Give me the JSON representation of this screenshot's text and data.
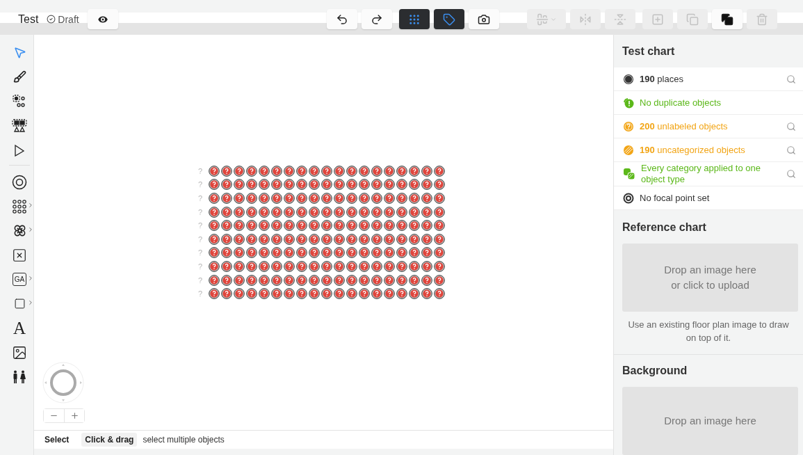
{
  "header": {
    "title": "Test",
    "status": "Draft"
  },
  "toolbar": [
    {
      "kind": "preview",
      "active": false,
      "disabled": false
    },
    {
      "kind": "undo",
      "active": false,
      "disabled": false
    },
    {
      "kind": "redo",
      "active": false,
      "disabled": false
    },
    {
      "kind": "select-places",
      "active": true,
      "disabled": false
    },
    {
      "kind": "labels",
      "active": true,
      "disabled": false
    },
    {
      "kind": "snapshot",
      "active": false,
      "disabled": false
    },
    {
      "kind": "align",
      "active": false,
      "disabled": true
    },
    {
      "kind": "flip-horizontal",
      "active": false,
      "disabled": true
    },
    {
      "kind": "flip-vertical",
      "active": false,
      "disabled": true
    },
    {
      "kind": "duplicate",
      "active": false,
      "disabled": true
    },
    {
      "kind": "copy",
      "active": false,
      "disabled": true
    },
    {
      "kind": "paste",
      "active": false,
      "disabled": false
    },
    {
      "kind": "delete",
      "active": false,
      "disabled": true
    }
  ],
  "tools": [
    {
      "kind": "pointer",
      "selected": true,
      "submenu": false
    },
    {
      "kind": "brush",
      "selected": false,
      "submenu": false
    },
    {
      "kind": "seat-select",
      "selected": false,
      "submenu": false
    },
    {
      "kind": "group-select",
      "selected": false,
      "submenu": false
    },
    {
      "kind": "node",
      "selected": false,
      "submenu": false
    },
    {
      "kind": "focal",
      "selected": false,
      "submenu": false
    },
    {
      "kind": "grid",
      "selected": false,
      "submenu": true
    },
    {
      "kind": "table",
      "selected": false,
      "submenu": true
    },
    {
      "kind": "booth",
      "selected": false,
      "submenu": false
    },
    {
      "kind": "area",
      "selected": false,
      "submenu": true,
      "label": "GA"
    },
    {
      "kind": "shape",
      "selected": false,
      "submenu": true
    },
    {
      "kind": "text",
      "selected": false,
      "submenu": false,
      "label": "A"
    },
    {
      "kind": "image",
      "selected": false,
      "submenu": false
    },
    {
      "kind": "icon",
      "selected": false,
      "submenu": false
    }
  ],
  "rows": [
    {
      "label": "?"
    },
    {
      "label": "?"
    },
    {
      "label": "?"
    },
    {
      "label": "?"
    },
    {
      "label": "?"
    },
    {
      "label": "?"
    },
    {
      "label": "?"
    },
    {
      "label": "?"
    },
    {
      "label": "?"
    },
    {
      "label": "?"
    }
  ],
  "status_bar": {
    "mode": "Select",
    "shortcut": "Click & drag",
    "hint": "select multiple objects"
  },
  "panel": {
    "title": "Test chart",
    "checks": [
      {
        "kind": "places",
        "text": "**190** places",
        "color": "#333333",
        "searchable": true
      },
      {
        "kind": "ok",
        "text": "No duplicate objects",
        "color": "#5cb81a",
        "searchable": false
      },
      {
        "kind": "unlabeled",
        "text": "**200** unlabeled objects",
        "color": "#f2a516",
        "searchable": true
      },
      {
        "kind": "uncategorized",
        "text": "**190** uncategorized objects",
        "color": "#f2a516",
        "searchable": true
      },
      {
        "kind": "category",
        "text": "Every category applied to one object type",
        "color": "#5cb81a",
        "searchable": true
      },
      {
        "kind": "focal",
        "text": "No focal point set",
        "color": "#333333",
        "searchable": false
      }
    ],
    "sections": [
      {
        "title": "Reference chart",
        "drop_lines": [
          "Drop an image here",
          "or click to upload"
        ],
        "hint": "Use an existing floor plan image to draw on top of it."
      },
      {
        "title": "Background",
        "drop_lines": [
          "Drop an image here"
        ]
      }
    ]
  }
}
